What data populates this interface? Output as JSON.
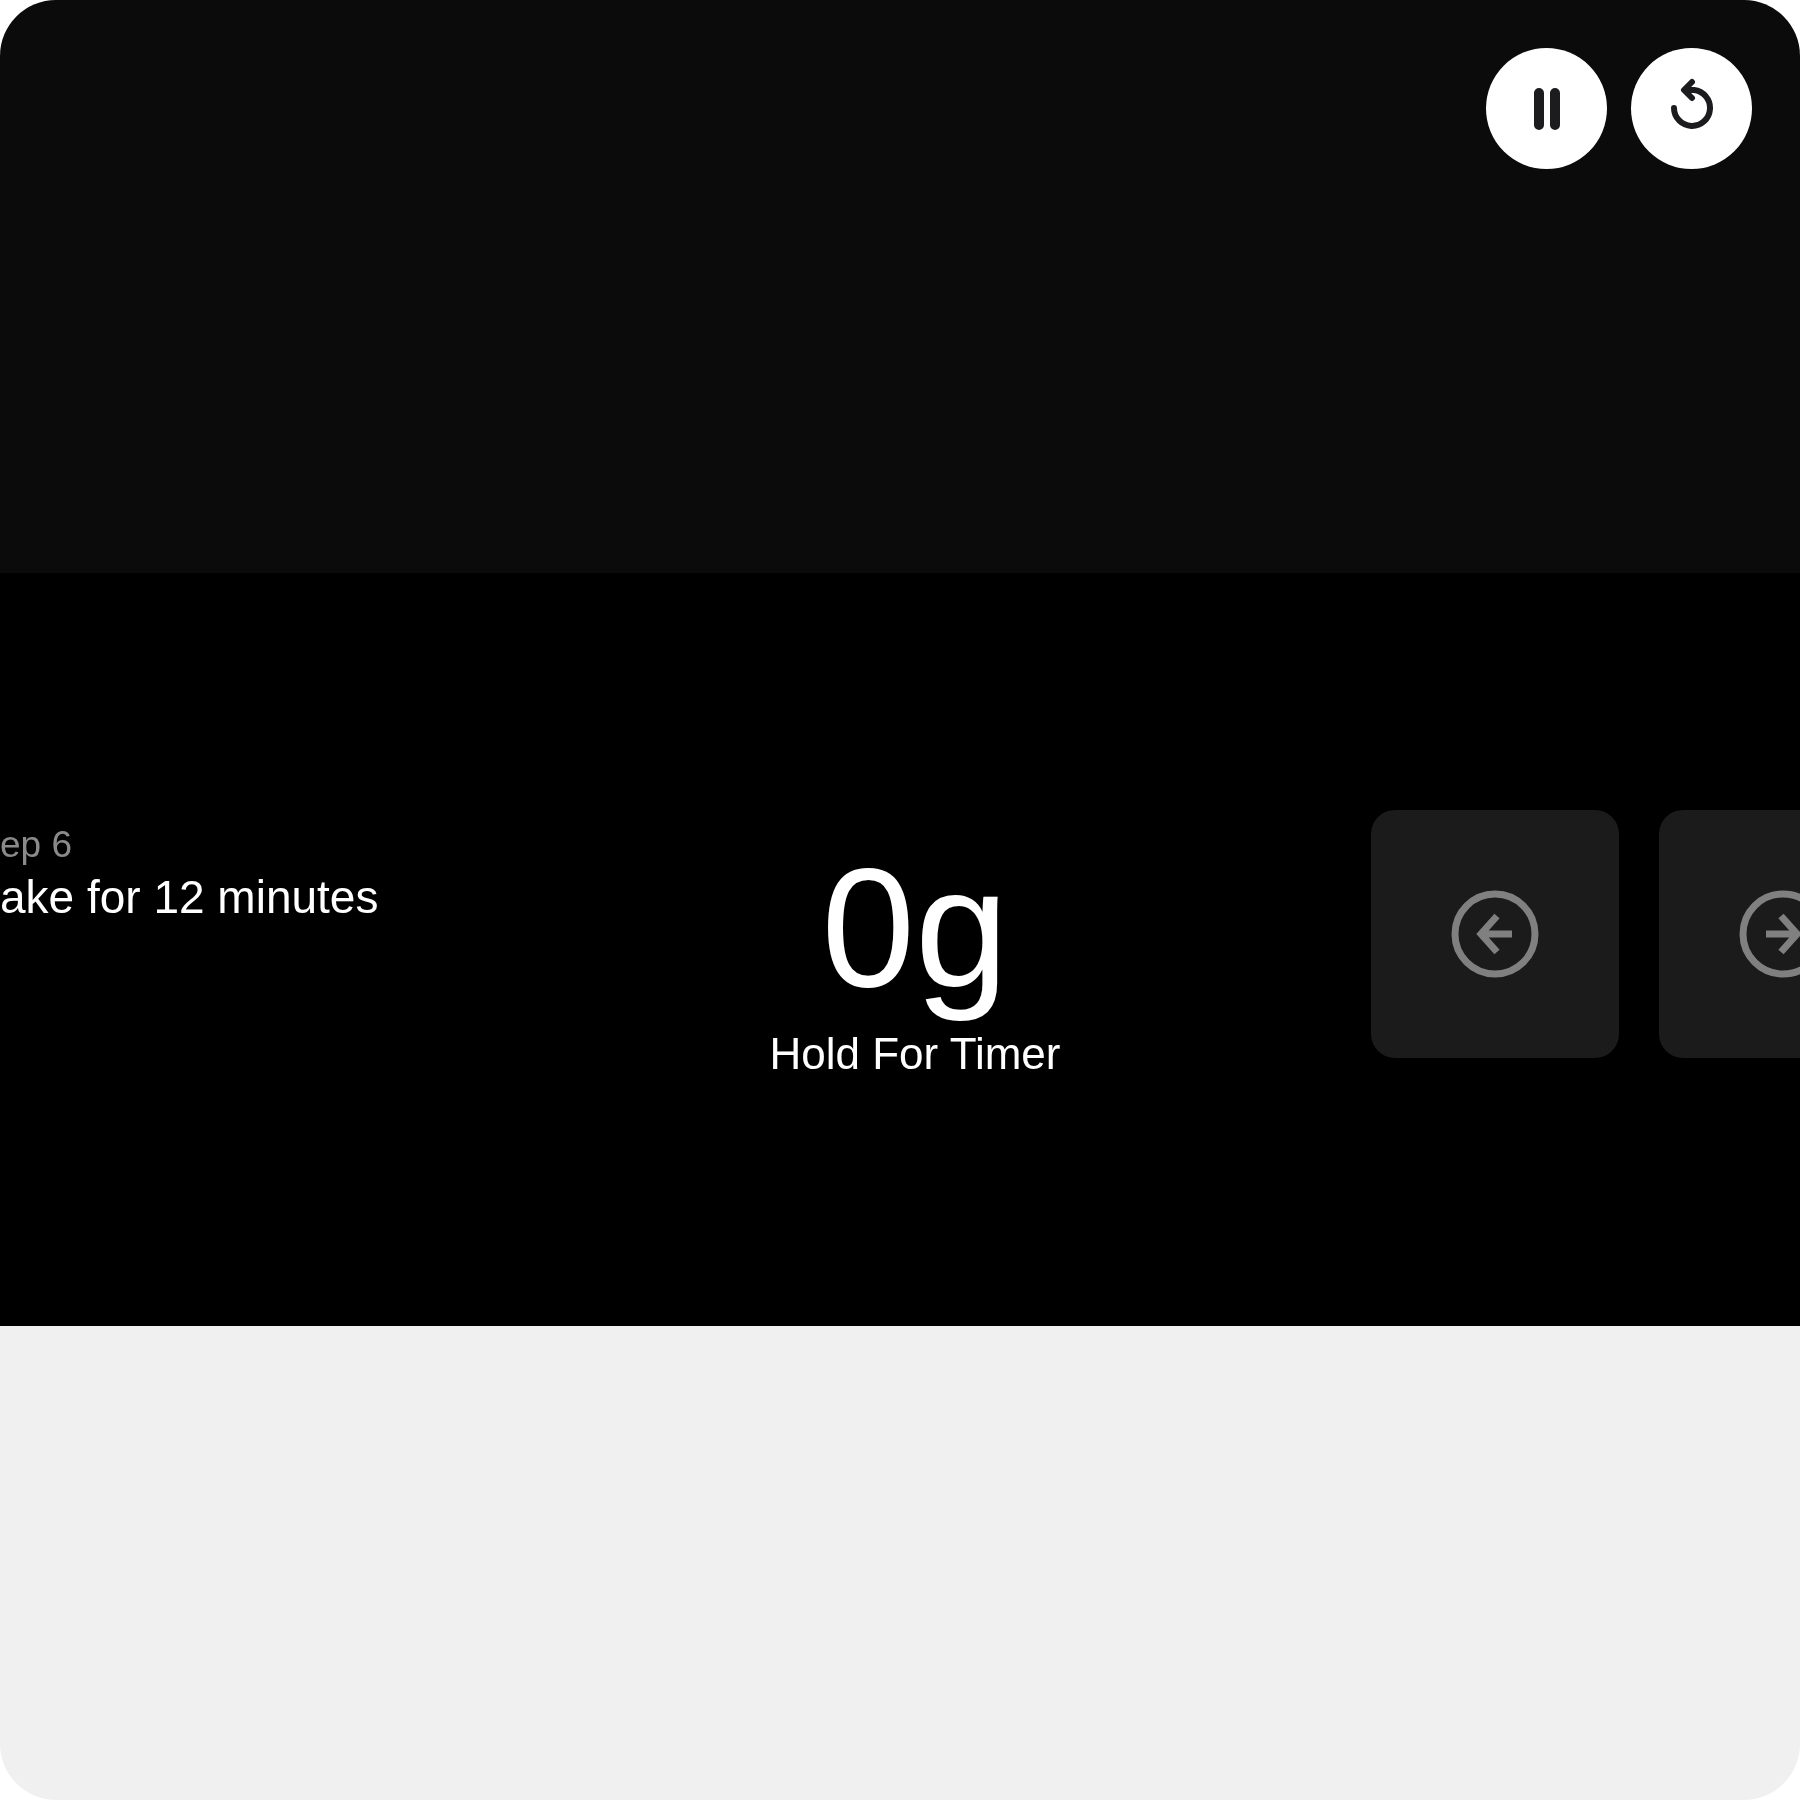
{
  "controls": [
    {
      "kind": "pause"
    },
    {
      "kind": "reset"
    }
  ],
  "step": {
    "label": "ep 6",
    "instruction": "ake for 12 minutes"
  },
  "scale": {
    "weight": "0g",
    "hint": "Hold For Timer"
  },
  "nav": [
    {
      "kind": "previous"
    },
    {
      "kind": "next"
    }
  ]
}
